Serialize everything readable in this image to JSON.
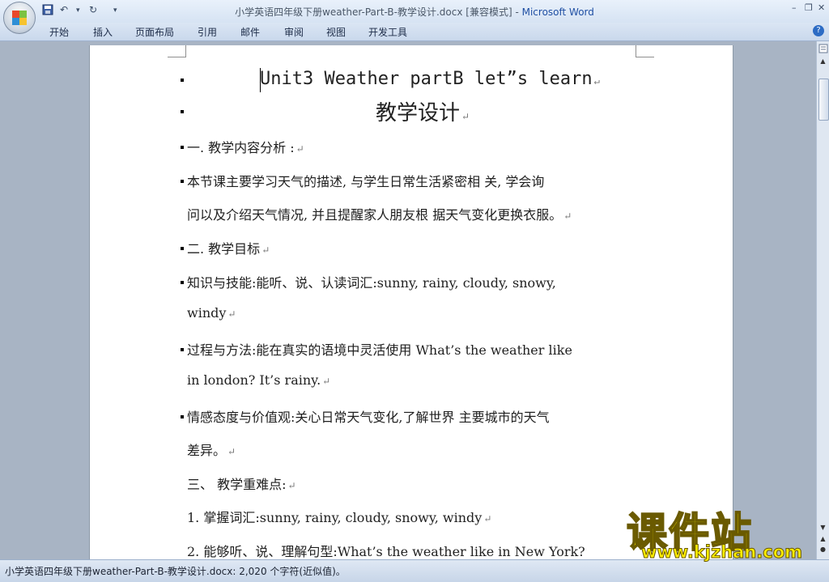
{
  "window": {
    "doc_title": "小学英语四年级下册weather-Part-B-教学设计.docx [兼容模式]",
    "separator": " - ",
    "app_name": "Microsoft Word",
    "minimize": "–",
    "restore": "❐",
    "close": "✕"
  },
  "quick_access": {
    "save_icon": "save-icon",
    "undo": "↶",
    "redo": "↻",
    "customize": "▾"
  },
  "ribbon": {
    "tabs": [
      "开始",
      "插入",
      "页面布局",
      "引用",
      "邮件",
      "审阅",
      "视图",
      "开发工具"
    ],
    "help": "?"
  },
  "document": {
    "title_line1": "Unit3 Weather partB let”s learn",
    "title_line2": "教学设计",
    "lines": [
      "一.  教学内容分析 :",
      "本节课主要学习天气的描述,  与学生日常生活紧密相 关,  学会询",
      "问以及介绍天气情况,  并且提醒家人朋友根 据天气变化更换衣服。",
      "二. 教学目标",
      "知识与技能:能听、说、认读词汇:sunny, rainy, cloudy, snowy,",
      "windy",
      "过程与方法:能在真实的语境中灵活使用 What’s the weather like",
      "in london? It’s rainy.",
      "情感态度与价值观:关心日常天气变化,了解世界 主要城市的天气",
      "差异。",
      "三、 教学重难点:",
      "1. 掌握词汇:sunny, rainy, cloudy, snowy, windy",
      "2. 能够听、说、理解句型:What’s the weather like in New York?"
    ],
    "paragraph_mark": "↵"
  },
  "status_bar": {
    "text": "小学英语四年级下册weather-Part-B-教学设计.docx: 2,020 个字符(近似值)。"
  },
  "watermark": {
    "main": "课件站",
    "url": "www.kjzhan.com"
  },
  "colors": {
    "accent": "#1f4fa3",
    "watermark": "#ffee00"
  }
}
